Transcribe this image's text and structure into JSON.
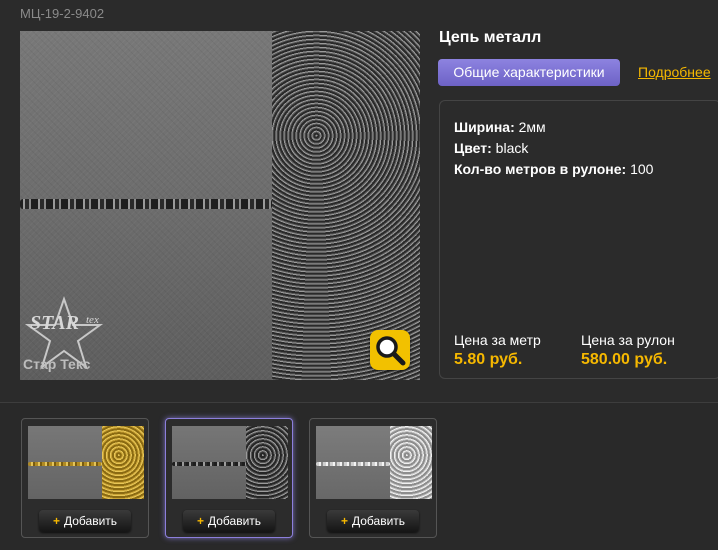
{
  "product": {
    "sku": "МЦ-19-2-9402",
    "title": "Цепь металл",
    "brand_name": "Стар Текс",
    "brand_logo_text": "STAR tex"
  },
  "tabs": {
    "active_label": "Общие характеристики",
    "more_label": "Подробнее"
  },
  "specs": [
    {
      "label": "Ширина:",
      "value": "2мм"
    },
    {
      "label": "Цвет:",
      "value": "black"
    },
    {
      "label": "Кол-во метров в рулоне:",
      "value": "100"
    }
  ],
  "prices": {
    "per_meter_label": "Цена за метр",
    "per_meter_value": "5.80 руб.",
    "per_roll_label": "Цена за рулон",
    "per_roll_value": "580.00 руб."
  },
  "thumbnails": [
    {
      "variant": "gold",
      "add_label": "Добавить",
      "selected": false
    },
    {
      "variant": "black",
      "add_label": "Добавить",
      "selected": true
    },
    {
      "variant": "silver",
      "add_label": "Добавить",
      "selected": false
    }
  ],
  "icons": {
    "zoom": "magnifier-icon",
    "add": "plus-icon"
  },
  "colors": {
    "accent": "#f6b800",
    "tab_active": "#7b70d4",
    "background": "#2b2b2b"
  }
}
